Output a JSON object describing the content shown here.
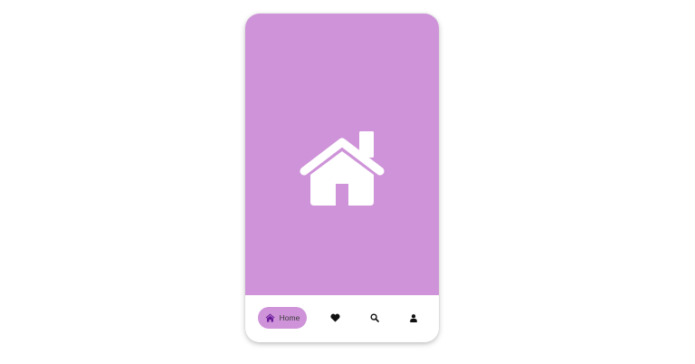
{
  "app": {
    "accent_color": "#ce93d8",
    "active_accent_color": "#6a1b9a",
    "hero_icon": "home-icon"
  },
  "navbar": {
    "items": [
      {
        "id": "home",
        "label": "Home",
        "icon": "home-icon",
        "active": true
      },
      {
        "id": "favorites",
        "label": "",
        "icon": "heart-icon",
        "active": false
      },
      {
        "id": "search",
        "label": "",
        "icon": "search-icon",
        "active": false
      },
      {
        "id": "profile",
        "label": "",
        "icon": "user-icon",
        "active": false
      }
    ]
  }
}
